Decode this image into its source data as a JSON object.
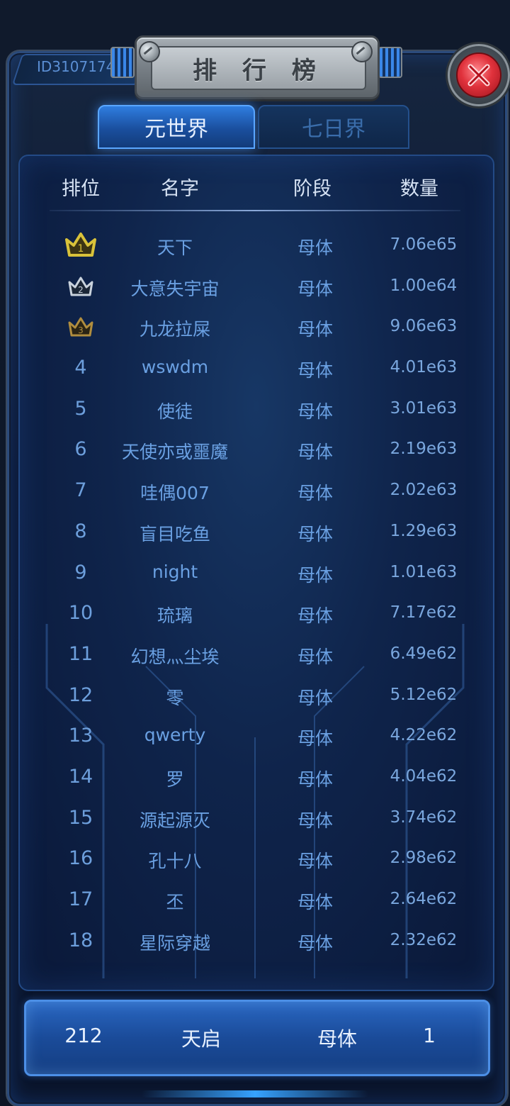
{
  "header": {
    "title": "排 行 榜",
    "player_id": "ID3107174"
  },
  "tabs": [
    {
      "label": "元世界",
      "active": true
    },
    {
      "label": "七日界",
      "active": false
    }
  ],
  "columns": {
    "rank": "排位",
    "name": "名字",
    "stage": "阶段",
    "quantity": "数量"
  },
  "rows": [
    {
      "rank": "1",
      "name": "天下",
      "stage": "母体",
      "quantity": "7.06e65",
      "badge": "gold-crown"
    },
    {
      "rank": "2",
      "name": "大意失宇宙",
      "stage": "母体",
      "quantity": "1.00e64",
      "badge": "silver-crown"
    },
    {
      "rank": "3",
      "name": "九龙拉屎",
      "stage": "母体",
      "quantity": "9.06e63",
      "badge": "bronze-crown"
    },
    {
      "rank": "4",
      "name": "wswdm",
      "stage": "母体",
      "quantity": "4.01e63"
    },
    {
      "rank": "5",
      "name": "使徒",
      "stage": "母体",
      "quantity": "3.01e63"
    },
    {
      "rank": "6",
      "name": "天使亦或噩魔",
      "stage": "母体",
      "quantity": "2.19e63"
    },
    {
      "rank": "7",
      "name": "哇偶007",
      "stage": "母体",
      "quantity": "2.02e63"
    },
    {
      "rank": "8",
      "name": "盲目吃鱼",
      "stage": "母体",
      "quantity": "1.29e63"
    },
    {
      "rank": "9",
      "name": "night",
      "stage": "母体",
      "quantity": "1.01e63"
    },
    {
      "rank": "10",
      "name": "琉璃",
      "stage": "母体",
      "quantity": "7.17e62"
    },
    {
      "rank": "11",
      "name": "幻想灬尘埃",
      "stage": "母体",
      "quantity": "6.49e62"
    },
    {
      "rank": "12",
      "name": "零",
      "stage": "母体",
      "quantity": "5.12e62"
    },
    {
      "rank": "13",
      "name": "qwerty",
      "stage": "母体",
      "quantity": "4.22e62"
    },
    {
      "rank": "14",
      "name": "罗",
      "stage": "母体",
      "quantity": "4.04e62"
    },
    {
      "rank": "15",
      "name": "源起源灭",
      "stage": "母体",
      "quantity": "3.74e62"
    },
    {
      "rank": "16",
      "name": "孔十八",
      "stage": "母体",
      "quantity": "2.98e62"
    },
    {
      "rank": "17",
      "name": "丕",
      "stage": "母体",
      "quantity": "2.64e62"
    },
    {
      "rank": "18",
      "name": "星际穿越",
      "stage": "母体",
      "quantity": "2.32e62"
    }
  ],
  "self": {
    "rank": "212",
    "name": "天启",
    "stage": "母体",
    "quantity": "1"
  },
  "colors": {
    "gold": "#d9c23a",
    "silver": "#c9d2dc",
    "bronze": "#b08d3e",
    "accent": "#3a87e8",
    "close_red": "#e0323c"
  }
}
